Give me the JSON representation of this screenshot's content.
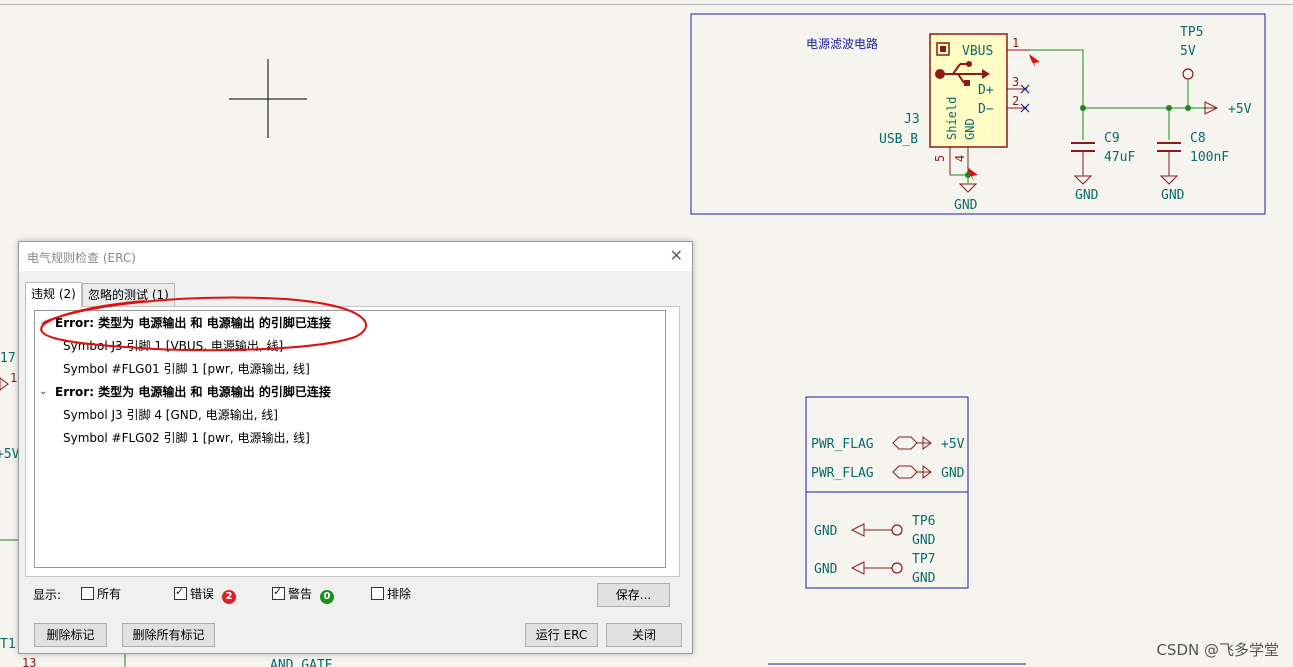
{
  "colors": {
    "wire": "#1b8a1b",
    "component": "#8b1a1a",
    "text": "#0b6b6b",
    "frame": "#2020a0",
    "component_fill": "#fffdc4",
    "badge_error": "#e02020",
    "badge_warning": "#1e8f1e",
    "annotation": "#e01010"
  },
  "schematic": {
    "block_title": "电源滤波电路",
    "j3_ref": "J3",
    "j3_value": "USB_B",
    "pin_vbus": "VBUS",
    "pin_dplus": "D+",
    "pin_dminus": "D−",
    "pin_shield": "Shield",
    "pin_gnd": "GND",
    "pin_num_1": "1",
    "pin_num_2": "2",
    "pin_num_3": "3",
    "pin_num_4": "4",
    "pin_num_5": "5",
    "tp5_ref": "TP5",
    "tp5_value": "5V",
    "net_5v": "+5V",
    "c9_ref": "C9",
    "c9_value": "47uF",
    "c8_ref": "C8",
    "c8_value": "100nF",
    "gnd": "GND",
    "pwr_flag_1": "PWR_FLAG",
    "pwr_flag_2": "PWR_FLAG",
    "flag_net_1": "+5V",
    "flag_net_2": "GND",
    "tp6_gnd": "GND",
    "tp6_ref": "TP6",
    "tp6_value": "GND",
    "tp7_gnd": "GND",
    "tp7_ref": "TP7",
    "tp7_value": "GND",
    "left_frag_1": "17",
    "left_frag_2": "1",
    "left_frag_3": "+5V",
    "left_frag_4": "T1",
    "left_frag_5": "13",
    "bottom_frag": "AND GATE"
  },
  "dialog": {
    "title": "电气规则检查 (ERC)",
    "close": "✕",
    "tabs": [
      "违规 (2)",
      "忽略的测试 (1)"
    ],
    "violations": [
      {
        "title": "Error: 类型为 电源输出 和 电源输出 的引脚已连接",
        "items": [
          "Symbol J3 引脚 1 [VBUS, 电源输出, 线]",
          "Symbol #FLG01 引脚 1 [pwr, 电源输出, 线]"
        ]
      },
      {
        "title": "Error: 类型为 电源输出 和 电源输出 的引脚已连接",
        "items": [
          "Symbol J3 引脚 4 [GND, 电源输出, 线]",
          "Symbol #FLG02 引脚 1 [pwr, 电源输出, 线]"
        ]
      }
    ],
    "show_label": "显示:",
    "filters": {
      "all": {
        "label": "所有",
        "checked": false
      },
      "errors": {
        "label": "错误",
        "checked": true,
        "count": "2"
      },
      "warnings": {
        "label": "警告",
        "checked": true,
        "count": "0"
      },
      "exclusions": {
        "label": "排除",
        "checked": false
      }
    },
    "buttons": {
      "save": "保存...",
      "delete_marker": "删除标记",
      "delete_all_markers": "删除所有标记",
      "run_erc": "运行 ERC",
      "close": "关闭"
    }
  },
  "watermark": "CSDN @飞多学堂"
}
